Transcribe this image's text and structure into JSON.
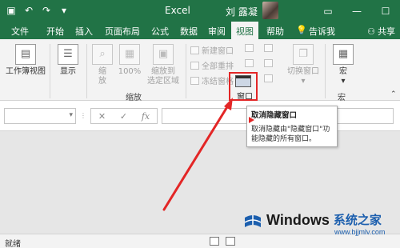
{
  "titlebar": {
    "app_title": "Excel",
    "user_name": "刘 露凝",
    "qat_icons": [
      "save-icon",
      "undo-icon",
      "redo-icon",
      "customize-icon"
    ]
  },
  "tabs": [
    "文件",
    "开始",
    "插入",
    "页面布局",
    "公式",
    "数据",
    "审阅",
    "视图",
    "帮助",
    "告诉我"
  ],
  "active_tab": "视图",
  "share_label": "共享",
  "ribbon": {
    "workbook_views": "工作簿视图",
    "show": "显示",
    "zoom": "缩\n放",
    "zoom_100": "100%",
    "zoom_to_selection": "缩放到\n选定区域",
    "zoom_group": "缩放",
    "new_window": "新建窗口",
    "arrange_all": "全部重排",
    "freeze_panes": "冻结窗格",
    "switch_windows": "切换窗口",
    "unhide_label": "窗口",
    "window_group": "窗口",
    "macros": "宏",
    "macros_group": "宏"
  },
  "tooltip": {
    "title": "取消隐藏窗口",
    "description": "取消隐藏由\"隐藏窗口\"功能隐藏的所有窗口。"
  },
  "formula_bar": {
    "name_box_value": "",
    "fx": "fx"
  },
  "status_bar": {
    "status": "就绪"
  },
  "watermark": {
    "brand": "Windows",
    "site": "系统之家",
    "url": "www.bjjmlv.com"
  },
  "colors": {
    "excel_green": "#217346",
    "highlight_red": "#e32626"
  }
}
